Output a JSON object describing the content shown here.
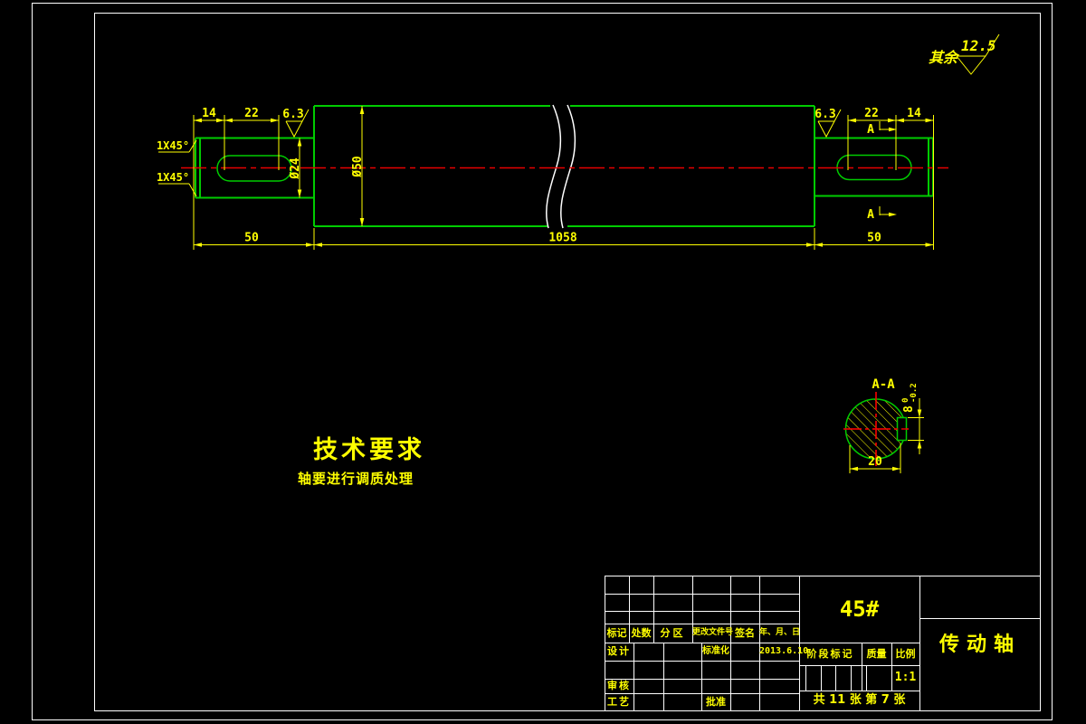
{
  "colors": {
    "background": "#000000",
    "outline_green": "#00cc00",
    "centerline_red": "#e60000",
    "annotation_yellow": "#ffff00",
    "frame_white": "#ffffff"
  },
  "surface_note": {
    "prefix": "其余",
    "roughness": "12.5"
  },
  "view": {
    "left_len1": "14",
    "left_len2": "22",
    "left_rough": "6.3",
    "chamfer_top": "1X45°",
    "chamfer_bottom": "1X45°",
    "dia_journal": "Ø24",
    "dia_body": "Ø50",
    "right_len1": "22",
    "right_len2": "14",
    "right_rough": "6.3",
    "seg_left": "50",
    "seg_mid": "1058",
    "seg_right": "50",
    "section_mark": "A"
  },
  "section": {
    "title": "A-A",
    "width": "20",
    "key_width": "8",
    "tol_upper": "0",
    "tol_lower": "-0.2"
  },
  "tech_req": {
    "title": "技术要求",
    "item1": "轴要进行调质处理"
  },
  "title_block": {
    "rev_headers": [
      "标记",
      "处数",
      "分区",
      "更改文件号",
      "签名",
      "年、月、日"
    ],
    "design": "设计",
    "standardize": "标准化",
    "date": "2013.6.10",
    "review": "审核",
    "process": "工艺",
    "approve": "批准",
    "material": "45#",
    "stage": "阶段标记",
    "weight": "质量",
    "scale": "比例",
    "scale_value": "1:1",
    "sheets": "共 11 张  第 7 张",
    "part_name": "传动轴"
  }
}
